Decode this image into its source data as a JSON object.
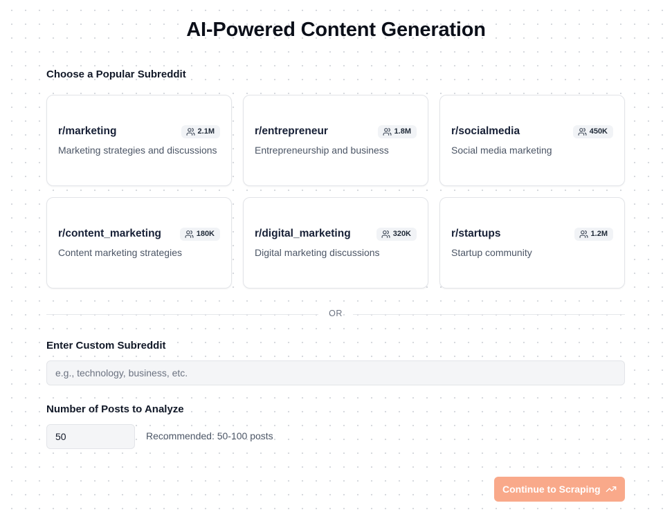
{
  "page": {
    "title": "AI-Powered Content Generation"
  },
  "popular": {
    "label": "Choose a Popular Subreddit",
    "subreddits": [
      {
        "name": "r/marketing",
        "members": "2.1M",
        "description": "Marketing strategies and discussions"
      },
      {
        "name": "r/entrepreneur",
        "members": "1.8M",
        "description": "Entrepreneurship and business"
      },
      {
        "name": "r/socialmedia",
        "members": "450K",
        "description": "Social media marketing"
      },
      {
        "name": "r/content_marketing",
        "members": "180K",
        "description": "Content marketing strategies"
      },
      {
        "name": "r/digital_marketing",
        "members": "320K",
        "description": "Digital marketing discussions"
      },
      {
        "name": "r/startups",
        "members": "1.2M",
        "description": "Startup community"
      }
    ]
  },
  "divider": {
    "text": "OR"
  },
  "custom": {
    "label": "Enter Custom Subreddit",
    "placeholder": "e.g., technology, business, etc.",
    "value": ""
  },
  "posts": {
    "label": "Number of Posts to Analyze",
    "value": "50",
    "hint": "Recommended: 50-100 posts"
  },
  "actions": {
    "continue_label": "Continue to Scraping",
    "continue_icon": "trending-up-icon"
  },
  "colors": {
    "accent": "#f9a98a",
    "text": "#0f172a",
    "muted": "#4b5565"
  }
}
